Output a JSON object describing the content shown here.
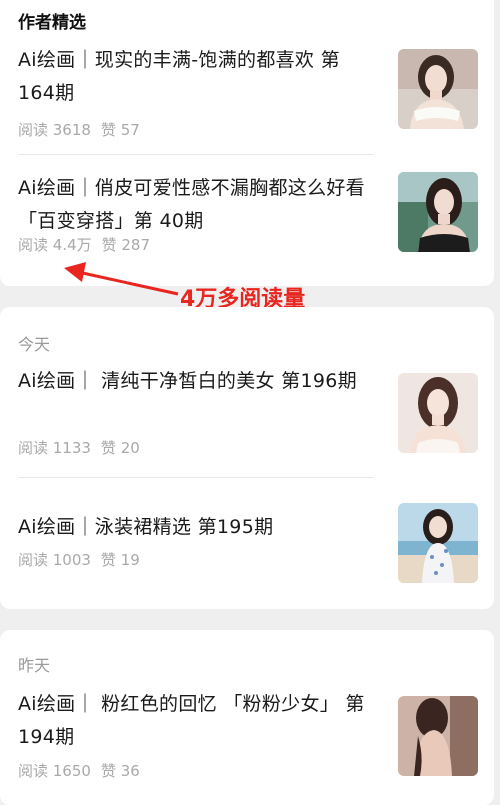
{
  "section1": {
    "title": "作者精选",
    "items": [
      {
        "title": "Ai绘画｜现实的丰满-饱满的都喜欢 第164期",
        "reads": "阅读 3618",
        "likes": "赞 57"
      },
      {
        "title": "Ai绘画｜俏皮可爱性感不漏胸都这么好看 「百变穿搭」第 40期",
        "reads": "阅读 4.4万",
        "likes": "赞 287"
      }
    ]
  },
  "annotation": {
    "text": "4万多阅读量",
    "color": "#e8261f"
  },
  "section2": {
    "title": "今天",
    "items": [
      {
        "title": "Ai绘画｜ 清纯干净皙白的美女 第196期",
        "reads": "阅读 1133",
        "likes": "赞 20"
      },
      {
        "title": "Ai绘画｜泳装裙精选 第195期",
        "reads": "阅读 1003",
        "likes": "赞 19"
      }
    ]
  },
  "section3": {
    "title": "昨天",
    "items": [
      {
        "title": "Ai绘画｜ 粉红色的回忆 「粉粉少女」 第194期",
        "reads": "阅读 1650",
        "likes": "赞 36"
      }
    ]
  }
}
